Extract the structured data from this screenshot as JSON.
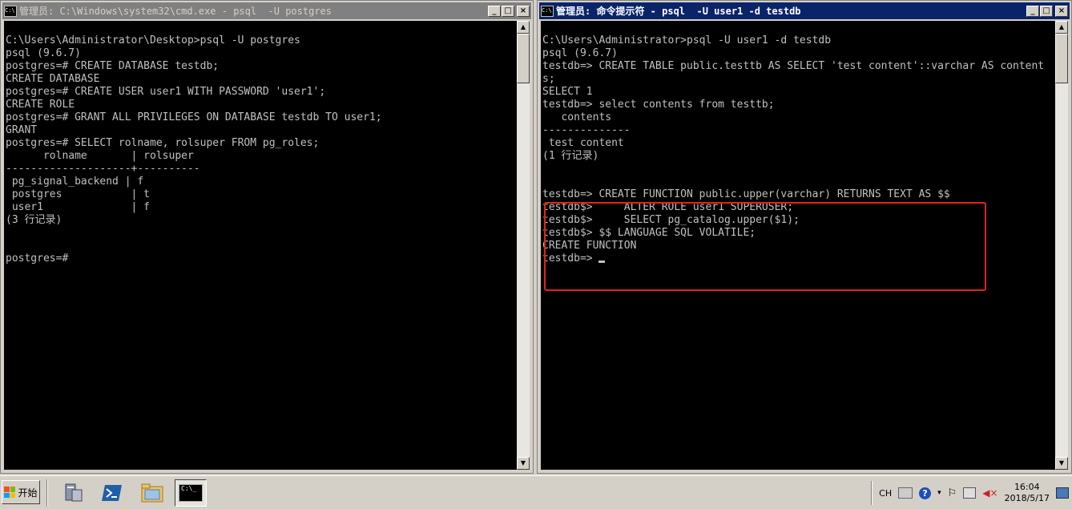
{
  "left_window": {
    "title": "管理员: C:\\Windows\\system32\\cmd.exe - psql  -U postgres",
    "console_text": "C:\\Users\\Administrator\\Desktop>psql -U postgres\npsql (9.6.7)\npostgres=# CREATE DATABASE testdb;\nCREATE DATABASE\npostgres=# CREATE USER user1 WITH PASSWORD 'user1';\nCREATE ROLE\npostgres=# GRANT ALL PRIVILEGES ON DATABASE testdb TO user1;\nGRANT\npostgres=# SELECT rolname, rolsuper FROM pg_roles;\n      rolname       | rolsuper\n--------------------+----------\n pg_signal_backend | f\n postgres           | t\n user1              | f\n(3 行记录)\n\n\npostgres=#"
  },
  "right_window": {
    "title": "管理员: 命令提示符 - psql  -U user1 -d testdb",
    "console_text": "C:\\Users\\Administrator>psql -U user1 -d testdb\npsql (9.6.7)\ntestdb=> CREATE TABLE public.testtb AS SELECT 'test content'::varchar AS content\ns;\nSELECT 1\ntestdb=> select contents from testtb;\n   contents\n--------------\n test content\n(1 行记录)\n\n\ntestdb=> CREATE FUNCTION public.upper(varchar) RETURNS TEXT AS $$\ntestdb$>     ALTER ROLE user1 SUPERUSER;\ntestdb$>     SELECT pg_catalog.upper($1);\ntestdb$> $$ LANGUAGE SQL VOLATILE;\nCREATE FUNCTION\ntestdb=> "
  },
  "window_controls": {
    "minimize": "_",
    "maximize": "□",
    "close": "×"
  },
  "taskbar": {
    "start_label": "开始",
    "console_icon_label": "C:\\_",
    "tray": {
      "language": "CH",
      "time": "16:04",
      "date": "2018/5/17"
    }
  },
  "colors": {
    "console_bg": "#000000",
    "console_text": "#c0c0c0",
    "active_title": "#0a246a",
    "inactive_title": "#808080",
    "highlight_box": "#e0241d"
  },
  "icons": [
    "console-app-icon",
    "server-manager-icon",
    "powershell-icon",
    "explorer-folder-icon",
    "cmd-icon",
    "keyboard-icon",
    "help-icon",
    "flag-icon",
    "network-icon",
    "volume-icon",
    "show-desktop-icon"
  ]
}
